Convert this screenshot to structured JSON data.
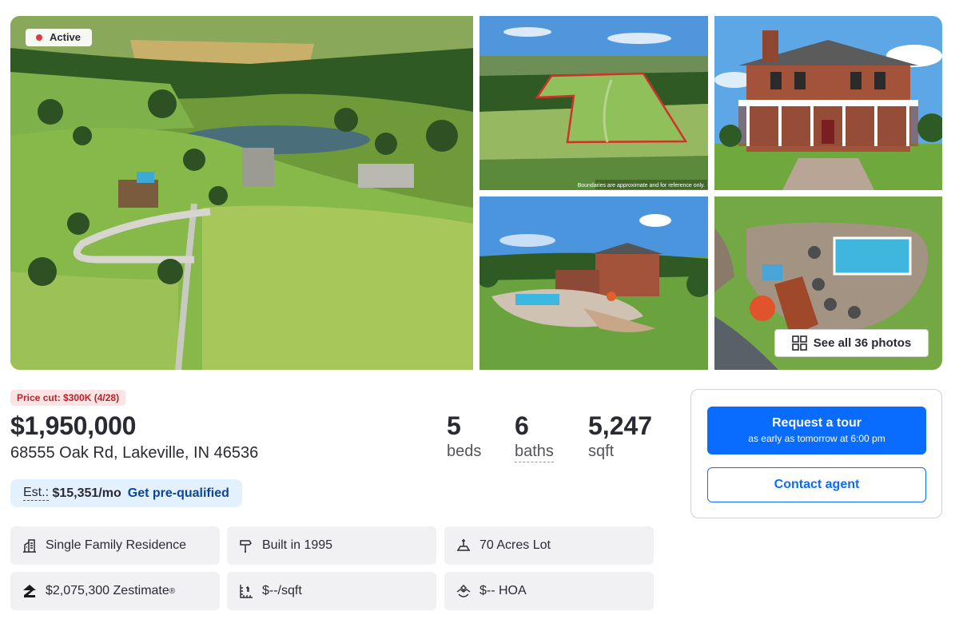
{
  "listing": {
    "status": "Active",
    "see_all_photos": "See all 36 photos",
    "price_cut": "Price cut: $300K (4/28)",
    "price": "$1,950,000",
    "address": "68555 Oak Rd, Lakeville, IN 46536",
    "stats": {
      "beds_value": "5",
      "beds_label": "beds",
      "baths_value": "6",
      "baths_label": "baths",
      "sqft_value": "5,247",
      "sqft_label": "sqft"
    },
    "estimate": {
      "label": "Est.:",
      "amount": "$15,351/mo",
      "link": "Get pre-qualified"
    },
    "facts": {
      "type": "Single Family Residence",
      "built": "Built in 1995",
      "lot": "70 Acres Lot",
      "zestimate": "$2,075,300 Zestimate",
      "zestimate_mark": "®",
      "price_per_sqft": "$--/sqft",
      "hoa": "$-- HOA"
    }
  },
  "contact": {
    "tour_title": "Request a tour",
    "tour_subtitle": "as early as tomorrow at 6:00 pm",
    "contact_agent": "Contact agent"
  },
  "photos": {
    "field_caption": "Boundaries are approximate and for reference only."
  },
  "icons": {
    "status": "red-dot-icon",
    "see_all": "grid-icon",
    "type": "building-icon",
    "built": "hammer-icon",
    "lot": "lot-icon",
    "zestimate": "zillow-logo-icon",
    "price_per_sqft": "ruler-icon",
    "hoa": "hands-icon"
  },
  "colors": {
    "primary": "#0a6bff",
    "status_dot": "#e0393e",
    "price_cut_bg": "#fde4e4",
    "price_cut_text": "#b7242a",
    "estimate_bg": "#e3f0fe",
    "link": "#0d4599"
  }
}
